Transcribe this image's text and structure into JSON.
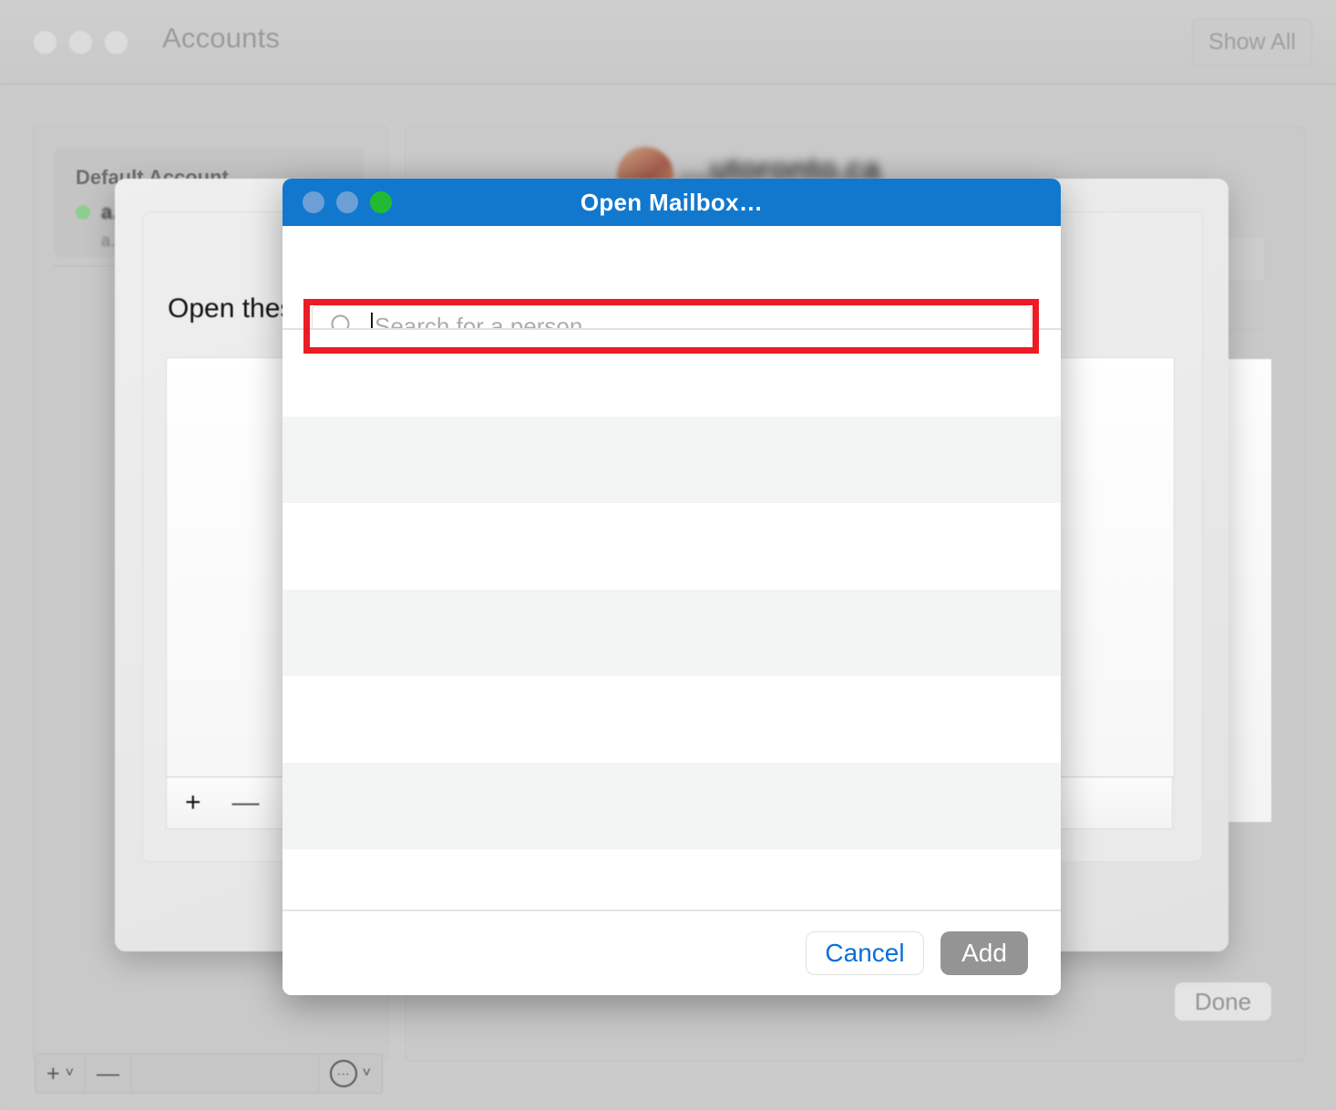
{
  "prefs_window": {
    "title": "Accounts",
    "show_all_label": "Show All",
    "traffic_lights": [
      "close-button",
      "minimize-button",
      "zoom-button"
    ],
    "accounts_panel": {
      "section_header": "Default Account",
      "account_name": "a…",
      "account_sub": "a…",
      "status": "online"
    },
    "detail_panel": {
      "email_blurred": "…utoronto.ca",
      "done_label": "Done"
    },
    "bottom_toolbar": {
      "add_label": "+",
      "add_chevron": "˅",
      "remove_label": "—",
      "action_label": "⋯",
      "action_chevron": "˅"
    }
  },
  "mailboxes_sheet": {
    "prompt": "Open these additional mailboxes:",
    "add_label": "+",
    "remove_label": "—"
  },
  "dialog": {
    "title": "Open Mailbox…",
    "traffic_lights": [
      "close-button",
      "minimize-button",
      "zoom-button"
    ],
    "search": {
      "placeholder": "Search for a person...",
      "value": "",
      "icon": "search-icon",
      "highlight_color": "#ed1c24"
    },
    "list": {
      "rows": [
        {
          "label": ""
        },
        {
          "label": ""
        },
        {
          "label": ""
        },
        {
          "label": ""
        },
        {
          "label": ""
        },
        {
          "label": ""
        },
        {
          "label": ""
        }
      ]
    },
    "footer": {
      "cancel_label": "Cancel",
      "add_label": "Add"
    },
    "colors": {
      "titlebar": "#1278ce",
      "accent_blue": "#0a6fd8",
      "add_button": "#949494",
      "row_alt": "#f3f5f5"
    }
  }
}
